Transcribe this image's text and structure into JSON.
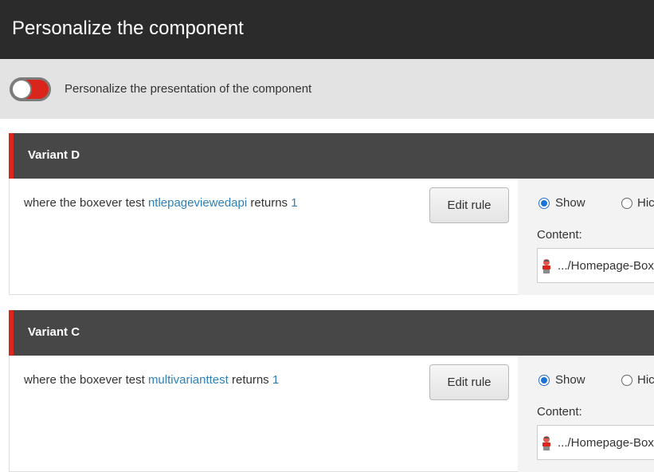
{
  "header": {
    "title": "Personalize the component"
  },
  "personalize_toggle": {
    "label": "Personalize the presentation of the component",
    "state": "off"
  },
  "variants": [
    {
      "title": "Variant D",
      "rule": {
        "prefix": "where the boxever test",
        "test_name": "ntlepageviewedapi",
        "middle": "returns",
        "value": "1"
      },
      "edit_label": "Edit rule",
      "show_label": "Show",
      "hide_label": "Hic",
      "selected": "show",
      "content_label": "Content:",
      "content_value": ".../Homepage-Box"
    },
    {
      "title": "Variant C",
      "rule": {
        "prefix": "where the boxever test",
        "test_name": "multivarianttest",
        "middle": "returns",
        "value": "1"
      },
      "edit_label": "Edit rule",
      "show_label": "Show",
      "hide_label": "Hic",
      "selected": "show",
      "content_label": "Content:",
      "content_value": ".../Homepage-Box"
    }
  ],
  "colors": {
    "accent": "#d9251c",
    "header_bg": "#2b2b2b",
    "variant_bg": "#474747",
    "link": "#2f80b8",
    "radio": "#1a73d9"
  },
  "icons": {
    "content_item": "person-icon"
  }
}
